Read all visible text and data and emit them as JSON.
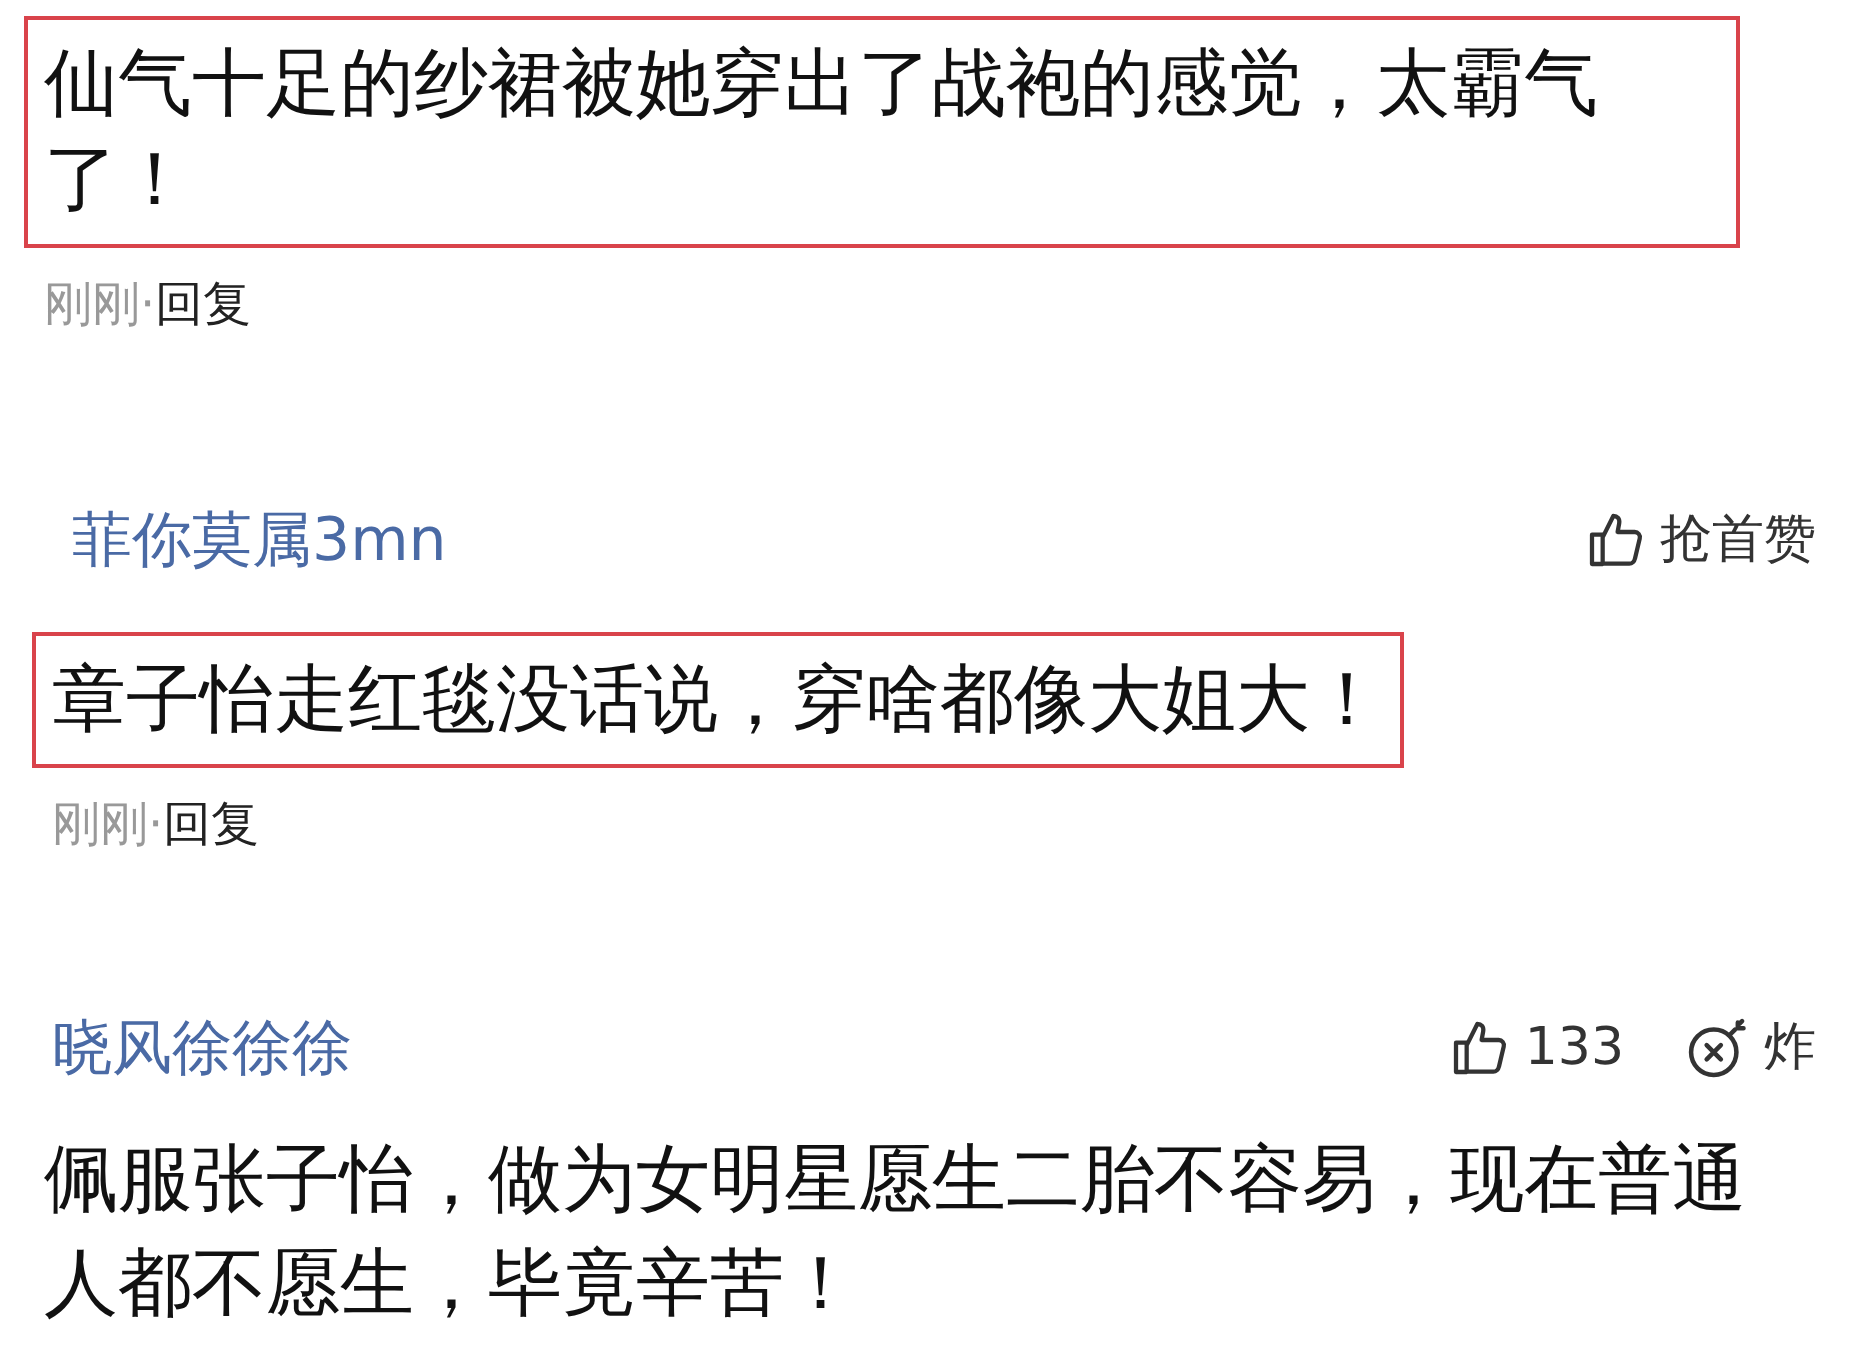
{
  "comments": [
    {
      "text": "仙气十足的纱裙被她穿出了战袍的感觉，太霸气了！",
      "highlighted": true,
      "time": "刚刚·",
      "reply": "回复"
    },
    {
      "user": "菲你莫属3mn",
      "likes": "抢首赞",
      "text": "章子怡走红毯没话说，穿啥都像大姐大！",
      "highlighted": true,
      "time": "刚刚·",
      "reply": "回复"
    },
    {
      "user": "晓风徐徐徐",
      "likes": "133",
      "bomb": "炸",
      "text": "佩服张子怡，做为女明星愿生二胎不容易，现在普通人都不愿生，毕竟辛苦！",
      "highlighted": false
    }
  ]
}
